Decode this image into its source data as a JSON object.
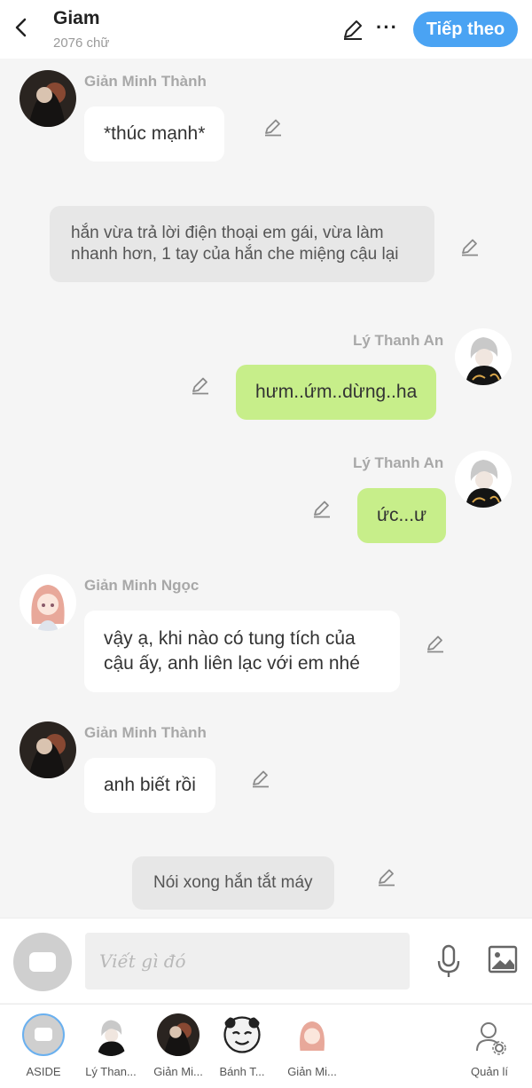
{
  "header": {
    "title": "Giam",
    "subtitle": "2076 chữ",
    "next_label": "Tiếp theo"
  },
  "messages": [
    {
      "sender": "Giản Minh Thành",
      "text": "*thúc mạnh*"
    },
    {
      "narration": "hắn vừa trả lời điện thoại em gái, vừa làm nhanh hơn, 1 tay của hắn che miệng cậu lại"
    },
    {
      "sender": "Lý Thanh An",
      "text": "hưm..ứm..dừng..ha"
    },
    {
      "sender": "Lý Thanh An",
      "text": "ức...ư"
    },
    {
      "sender": "Giản Minh Ngọc",
      "text": "vậy ạ, khi nào có tung tích của cậu ấy, anh liên lạc với em nhé"
    },
    {
      "sender": "Giản Minh Thành",
      "text": "anh biết rồi"
    },
    {
      "narration": "Nói xong hắn tắt máy"
    }
  ],
  "composer": {
    "placeholder": "Viết gì đó"
  },
  "tabs": [
    {
      "label": "ASIDE"
    },
    {
      "label": "Lý Than..."
    },
    {
      "label": "Giản Mi..."
    },
    {
      "label": "Bánh T..."
    },
    {
      "label": "Giản Mi..."
    },
    {
      "label": "Quản lí"
    }
  ],
  "colors": {
    "accent": "#4aa3f3",
    "self_bubble": "#c7ee8a",
    "other_bubble": "#ffffff",
    "narration_bubble": "#e7e7e7"
  }
}
